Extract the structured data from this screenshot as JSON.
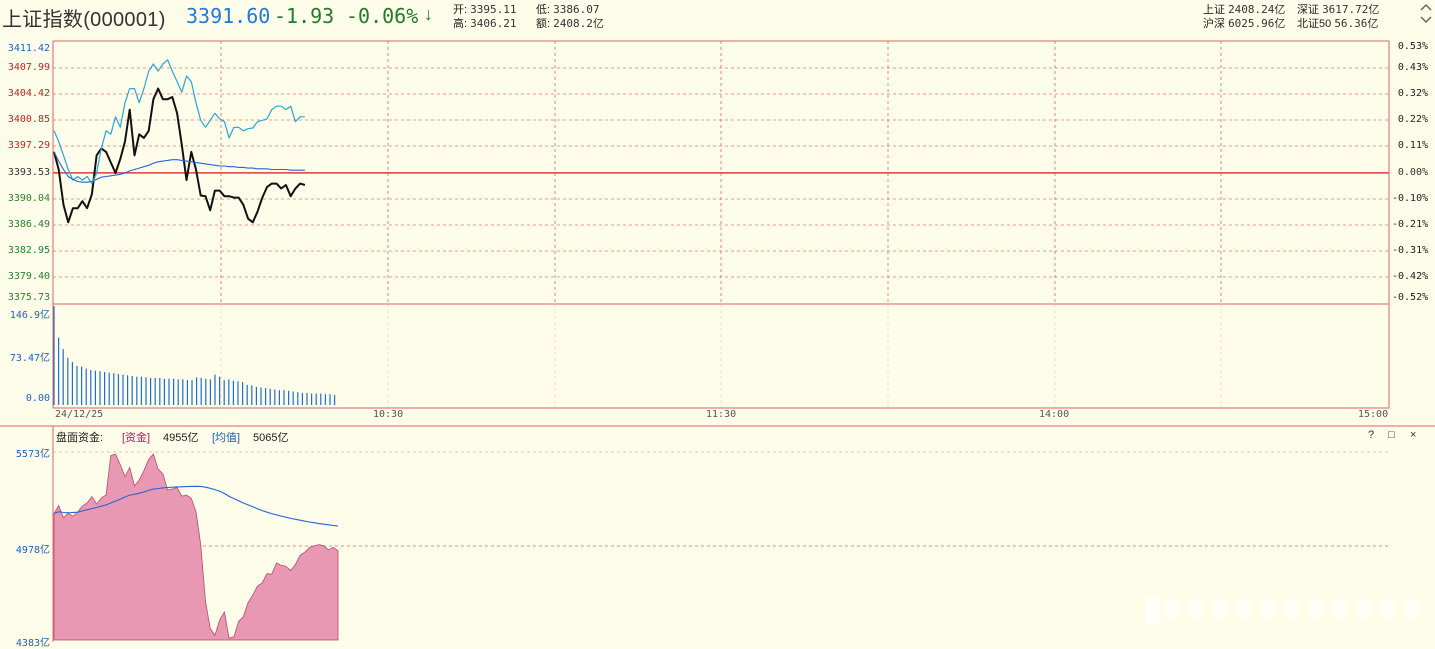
{
  "header": {
    "title": "上证指数(000001)",
    "price": "3391.60",
    "change": "-1.93",
    "change_pct": "-0.06%",
    "arrow": "↓",
    "open_label": "开:",
    "open": "3395.11",
    "low_label": "低:",
    "low": "3386.07",
    "high_label": "高:",
    "high": "3406.21",
    "amount_label": "额:",
    "amount": "2408.2亿",
    "markets": [
      {
        "label": "上证",
        "value": "2408.24亿"
      },
      {
        "label": "深证",
        "value": "3617.72亿"
      },
      {
        "label": "沪深",
        "value": "6025.96亿"
      },
      {
        "label": "北证50",
        "value": "56.36亿"
      }
    ],
    "colors": {
      "price": "#1f7bd6",
      "down": "#237a2b"
    }
  },
  "price_axis": {
    "left": [
      "3411.42",
      "3407.99",
      "3404.42",
      "3400.85",
      "3397.29",
      "3393.53",
      "3390.04",
      "3386.49",
      "3382.95",
      "3379.40",
      "3375.73"
    ],
    "right": [
      "0.53%",
      "0.43%",
      "0.32%",
      "0.22%",
      "0.11%",
      "0.00%",
      "-0.10%",
      "-0.21%",
      "-0.31%",
      "-0.42%",
      "-0.52%"
    ]
  },
  "volume_axis": [
    "146.9亿",
    "73.47亿",
    "0.00"
  ],
  "time_axis": [
    "24/12/25",
    "10:30",
    "11:30",
    "14:00",
    "15:00"
  ],
  "fund_panel": {
    "title": "盘面资金:",
    "fund_tag": "[资金]",
    "fund_value": "4955亿",
    "avg_tag": "[均值]",
    "avg_value": "5065亿",
    "axis": [
      "5573亿",
      "4978亿",
      "4383亿"
    ],
    "tools": [
      "?",
      "□",
      "×"
    ]
  },
  "chart_data": [
    {
      "type": "line",
      "title": "",
      "xlabel": "",
      "ylabel": "",
      "ylim": [
        3375.73,
        3411.42
      ],
      "baseline": 3393.53,
      "series": [
        {
          "values": [
            3396.5,
            3394,
            3389,
            3386.5,
            3388.5,
            3388.5,
            3389.5,
            3388.5,
            3390.5,
            3396,
            3397,
            3396.5,
            3395,
            3393.5,
            3395.5,
            3398,
            3402.5,
            3396,
            3399,
            3398.5,
            3399.5,
            3404,
            3405.5,
            3404,
            3404,
            3404.3,
            3402,
            3397.5,
            3392.5,
            3396.5,
            3394,
            3390.3,
            3390.2,
            3388.2,
            3391,
            3391,
            3390.2,
            3390.2,
            3390,
            3390,
            3389,
            3387,
            3386.5,
            3388,
            3390,
            3391.5,
            3392,
            3392,
            3391.3,
            3391.8,
            3390.2,
            3391.3,
            3392,
            3391.8
          ]
        },
        {
          "values": [
            3399.5,
            3398,
            3396,
            3394,
            3392.5,
            3393,
            3392.5,
            3393,
            3392,
            3393.5,
            3397,
            3399.5,
            3399,
            3401.5,
            3400,
            3403.5,
            3405.5,
            3405.5,
            3403.5,
            3405.5,
            3408,
            3409,
            3408,
            3409,
            3409.6,
            3408,
            3406.5,
            3405,
            3407.3,
            3406.5,
            3403.5,
            3401,
            3400,
            3401,
            3402,
            3401.2,
            3400.8,
            3398.5,
            3400,
            3400,
            3399.5,
            3399.8,
            3399.9,
            3400.8,
            3401,
            3401.2,
            3402.5,
            3403,
            3403,
            3402.5,
            3403,
            3400.8,
            3401.5,
            3401.5
          ]
        },
        {
          "values": [
            3396.5,
            3395.2,
            3394,
            3393,
            3392.6,
            3392.3,
            3392.2,
            3392.2,
            3392.3,
            3392.6,
            3392.9,
            3393,
            3393.1,
            3393.2,
            3393.3,
            3393.5,
            3393.8,
            3394,
            3394.2,
            3394.4,
            3394.6,
            3394.9,
            3395.1,
            3395.2,
            3395.3,
            3395.4,
            3395.4,
            3395.3,
            3395.2,
            3395.1,
            3395,
            3394.9,
            3394.8,
            3394.7,
            3394.6,
            3394.5,
            3394.5,
            3394.4,
            3394.4,
            3394.3,
            3394.3,
            3394.2,
            3394.2,
            3394.1,
            3394.1,
            3394.1,
            3394,
            3394,
            3394,
            3394,
            3393.9,
            3393.9,
            3393.9,
            3393.9
          ]
        }
      ]
    },
    {
      "type": "bar",
      "title": "",
      "ylim": [
        0,
        146.9
      ],
      "values": [
        146.9,
        100,
        83,
        70,
        64,
        58,
        57,
        54,
        52,
        51,
        50,
        49,
        48,
        47,
        46,
        45,
        44,
        43,
        42,
        42,
        41,
        40,
        40,
        40,
        39,
        39,
        39,
        38,
        38,
        37,
        37,
        41,
        40,
        39,
        38,
        45,
        42,
        37,
        38,
        36,
        35,
        34,
        30,
        29,
        27,
        26,
        25,
        24,
        23,
        22,
        22,
        21,
        20,
        19,
        18,
        18,
        17,
        17,
        17,
        16,
        16,
        15
      ]
    },
    {
      "type": "area",
      "title": "",
      "ylim": [
        4383,
        5573
      ],
      "series": [
        {
          "name": "资金",
          "values": [
            5184,
            5233,
            5156,
            5187,
            5166,
            5193,
            5231,
            5250,
            5291,
            5243,
            5282,
            5301,
            5550,
            5560,
            5493,
            5416,
            5475,
            5358,
            5395,
            5454,
            5527,
            5560,
            5464,
            5435,
            5332,
            5339,
            5348,
            5294,
            5301,
            5280,
            5194,
            4988,
            4626,
            4457,
            4412,
            4510,
            4560,
            4394,
            4403,
            4500,
            4530,
            4620,
            4667,
            4725,
            4745,
            4803,
            4799,
            4870,
            4856,
            4850,
            4823,
            4861,
            4919,
            4939,
            4969,
            4979,
            4986,
            4979,
            4954,
            4970,
            4948
          ]
        },
        {
          "name": "均值",
          "values": [
            5184,
            5195,
            5190,
            5188,
            5190,
            5192,
            5200,
            5208,
            5215,
            5222,
            5230,
            5238,
            5250,
            5262,
            5275,
            5288,
            5300,
            5305,
            5312,
            5320,
            5330,
            5338,
            5342,
            5346,
            5348,
            5350,
            5352,
            5353,
            5354,
            5355,
            5356,
            5355,
            5350,
            5343,
            5335,
            5325,
            5310,
            5292,
            5278,
            5264,
            5250,
            5238,
            5226,
            5214,
            5202,
            5192,
            5183,
            5175,
            5167,
            5160,
            5153,
            5147,
            5141,
            5135,
            5130,
            5125,
            5120,
            5116,
            5112,
            5108,
            5104
          ]
        }
      ]
    }
  ]
}
